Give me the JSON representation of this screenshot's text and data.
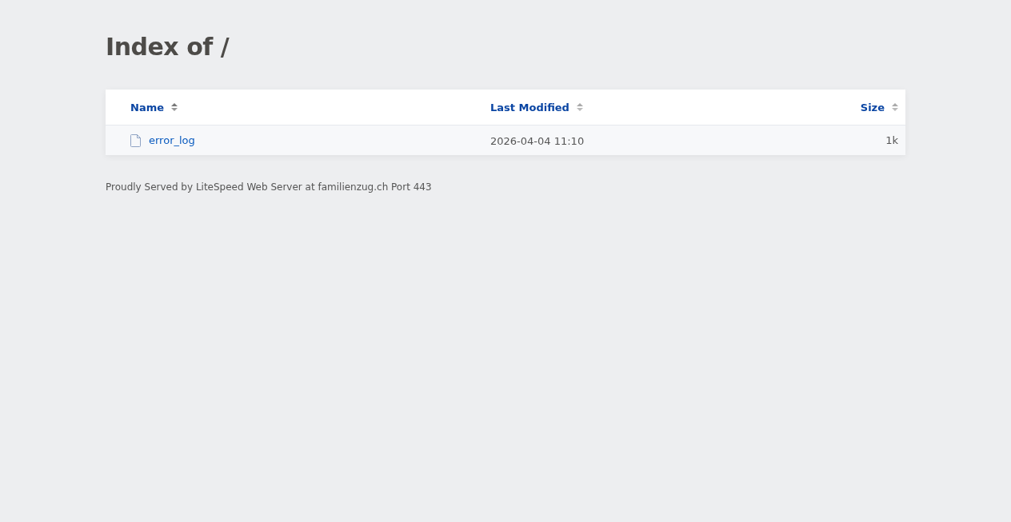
{
  "title": "Index of /",
  "table": {
    "columns": [
      {
        "label": "Name",
        "sorted": true
      },
      {
        "label": "Last Modified",
        "sorted": false
      },
      {
        "label": "Size",
        "sorted": false
      }
    ],
    "rows": [
      {
        "kind": "file",
        "name": "error_log",
        "modified": "2026-04-04 11:10",
        "size": "1k"
      }
    ]
  },
  "footer": "Proudly Served by LiteSpeed Web Server at familienzug.ch Port 443"
}
